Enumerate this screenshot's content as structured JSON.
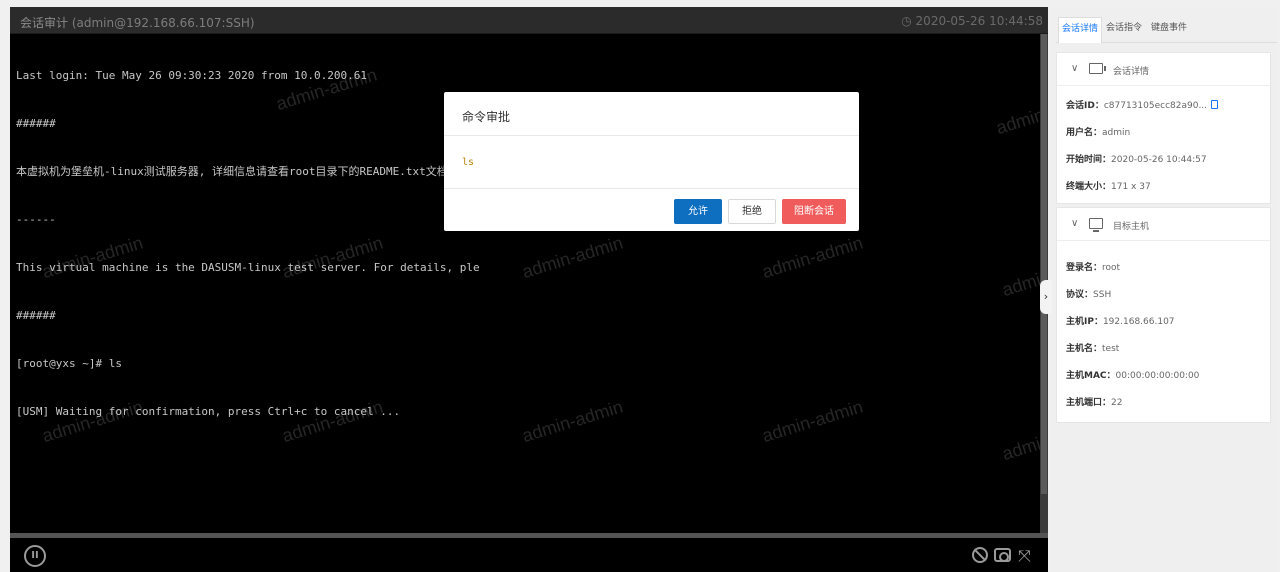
{
  "title_bar": {
    "title": "会话审计",
    "connection": "(admin@192.168.66.107:SSH)",
    "timestamp": "2020-05-26 10:44:58"
  },
  "terminal": {
    "lines": [
      "Last login: Tue May 26 09:30:23 2020 from 10.0.200.61",
      "######",
      "本虚拟机为堡垒机-linux测试服务器, 详细信息请查看root目录下的README.txt文档",
      "------",
      "This virtual machine is the DASUSM-linux test server. For details, ple",
      "######",
      "[root@yxs ~]# ls",
      "[USM] Waiting for confirmation, press Ctrl+c to cancel ..."
    ],
    "watermark": "admin-admin"
  },
  "dialog": {
    "title": "命令审批",
    "command": "ls",
    "allow_label": "允许",
    "deny_label": "拒绝",
    "block_label": "阻断会话"
  },
  "right_panel": {
    "tabs": [
      "会话详情",
      "会话指令",
      "键盘事件"
    ],
    "session_section": {
      "title": "会话详情",
      "fields": [
        {
          "key": "会话ID：",
          "value": "c87713105ecc82a90..."
        },
        {
          "key": "用户名：",
          "value": "admin"
        },
        {
          "key": "开始时间：",
          "value": "2020-05-26 10:44:57"
        },
        {
          "key": "终端大小：",
          "value": "171 x 37"
        }
      ]
    },
    "host_section": {
      "title": "目标主机",
      "fields": [
        {
          "key": "登录名：",
          "value": "root"
        },
        {
          "key": "协议：",
          "value": "SSH"
        },
        {
          "key": "主机IP：",
          "value": "192.168.66.107"
        },
        {
          "key": "主机名：",
          "value": "test"
        },
        {
          "key": "主机MAC：",
          "value": "00:00:00:00:00:00"
        },
        {
          "key": "主机端口：",
          "value": "22"
        }
      ]
    }
  },
  "icons": [
    "clock-icon",
    "pause-icon",
    "block-icon",
    "camera-icon",
    "expand-icon",
    "chevron-down-icon",
    "terminal-icon",
    "monitor-icon",
    "copy-icon",
    "chevron-right-icon"
  ],
  "colors": {
    "primary": "#0e6ebf",
    "danger": "#f05b5b",
    "link": "#1677ff",
    "command": "#b8860b"
  }
}
